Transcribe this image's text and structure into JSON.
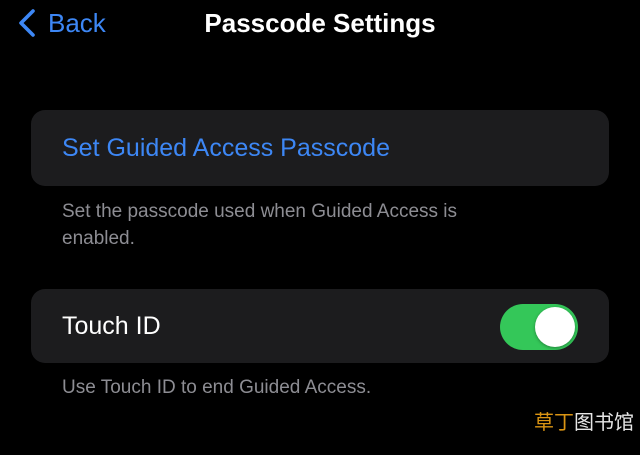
{
  "nav": {
    "back_label": "Back",
    "title": "Passcode Settings"
  },
  "passcode_group": {
    "link_label": "Set Guided Access Passcode",
    "note": "Set the passcode used when Guided Access is enabled."
  },
  "touchid_group": {
    "label": "Touch ID",
    "toggle_on": true,
    "note": "Use Touch ID to end Guided Access."
  },
  "watermark": {
    "part_a": "草丁",
    "part_b": "图书馆"
  },
  "colors": {
    "accent": "#3d87f5",
    "toggle_on": "#34c759",
    "cell_bg": "#1c1c1e",
    "note_text": "#8d8d93"
  },
  "icons": {
    "back": "chevron-left-icon"
  }
}
